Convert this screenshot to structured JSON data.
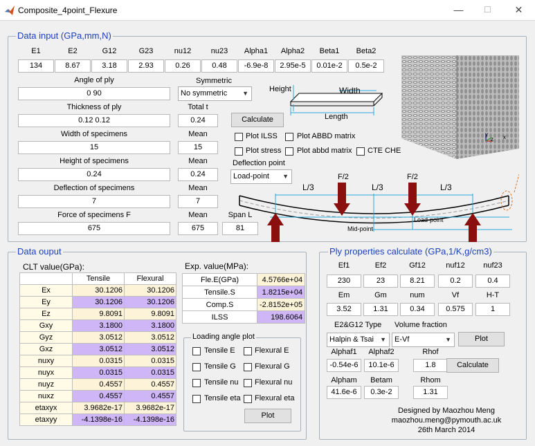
{
  "window": {
    "title": "Composite_4point_Flexure",
    "min": "—",
    "max": "☐",
    "close": "✕"
  },
  "data_input": {
    "title": "Data input (GPa,mm,N)",
    "props": [
      {
        "label": "E1",
        "value": "134"
      },
      {
        "label": "E2",
        "value": "8.67"
      },
      {
        "label": "G12",
        "value": "3.18"
      },
      {
        "label": "G23",
        "value": "2.93"
      },
      {
        "label": "nu12",
        "value": "0.26"
      },
      {
        "label": "nu23",
        "value": "0.48"
      },
      {
        "label": "Alpha1",
        "value": "-6.9e-8"
      },
      {
        "label": "Alpha2",
        "value": "2.95e-5"
      },
      {
        "label": "Beta1",
        "value": "0.01e-2"
      },
      {
        "label": "Beta2",
        "value": "0.5e-2"
      }
    ],
    "angle_label": "Angle of ply",
    "angle_value": "0 90",
    "symmetric_label": "Symmetric",
    "symmetric_value": "No symmetric",
    "thickness_label": "Thickness of ply",
    "thickness_value": "0.12 0.12",
    "total_label": "Total t",
    "total_value": "0.24",
    "width_label": "Width of specimens",
    "width_value": "15",
    "width_mean_label": "Mean",
    "width_mean": "15",
    "height_label": "Height of specimens",
    "height_value": "0.24",
    "height_mean_label": "Mean",
    "height_mean": "0.24",
    "deflection_label": "Deflection of specimens",
    "deflection_value": "7",
    "deflection_mean_label": "Mean",
    "deflection_mean": "7",
    "force_label": "Force of specimens F",
    "force_value": "675",
    "force_mean_label": "Mean",
    "force_mean": "675",
    "span_label": "Span L",
    "span_value": "81",
    "calculate": "Calculate",
    "plot_ilss": "Plot ILSS",
    "plot_abbd_upper": "Plot ABBD matrix",
    "plot_stress": "Plot stress",
    "plot_abbd_lower": "Plot abbd matrix",
    "cte_che": "CTE CHE",
    "deflection_point_label": "Deflection point",
    "deflection_point_value": "Load-point",
    "diagram": {
      "height": "Height",
      "width": "Width",
      "length": "Length",
      "f2_left": "F/2",
      "f2_right": "F/2",
      "l3_a": "L/3",
      "l3_b": "L/3",
      "l3_c": "L/3",
      "mid_point": "Mid-point",
      "load_point": "Load-point",
      "axis_y": "y",
      "axis_z": "z",
      "axis_x": "x"
    }
  },
  "data_output": {
    "title": "Data ouput",
    "clt_label": "CLT value(GPa):",
    "columns": [
      "",
      "Tensile",
      "Flexural"
    ],
    "rows": [
      {
        "name": "Ex",
        "tensile": "30.1206",
        "flexural": "30.1206"
      },
      {
        "name": "Ey",
        "tensile": "30.1206",
        "flexural": "30.1206"
      },
      {
        "name": "Ez",
        "tensile": "9.8091",
        "flexural": "9.8091"
      },
      {
        "name": "Gxy",
        "tensile": "3.1800",
        "flexural": "3.1800"
      },
      {
        "name": "Gyz",
        "tensile": "3.0512",
        "flexural": "3.0512"
      },
      {
        "name": "Gxz",
        "tensile": "3.0512",
        "flexural": "3.0512"
      },
      {
        "name": "nuxy",
        "tensile": "0.0315",
        "flexural": "0.0315"
      },
      {
        "name": "nuyx",
        "tensile": "0.0315",
        "flexural": "0.0315"
      },
      {
        "name": "nuyz",
        "tensile": "0.4557",
        "flexural": "0.4557"
      },
      {
        "name": "nuxz",
        "tensile": "0.4557",
        "flexural": "0.4557"
      },
      {
        "name": "etaxyx",
        "tensile": "3.9682e-17",
        "flexural": "3.9682e-17"
      },
      {
        "name": "etaxyy",
        "tensile": "-4.1398e-16",
        "flexural": "-4.1398e-16"
      }
    ],
    "exp_label": "Exp. value(MPa):",
    "exp_rows": [
      {
        "name": "Fle.E(GPa)",
        "value": "4.5766e+04",
        "color": "#fdf3d9"
      },
      {
        "name": "Tensile.S",
        "value": "1.8215e+04",
        "color": "#cfb6f7"
      },
      {
        "name": "Comp.S",
        "value": "-2.8152e+05",
        "color": "#fdf3d9"
      },
      {
        "name": "ILSS",
        "value": "198.6064",
        "color": "#cfb6f7"
      }
    ],
    "loading_title": "Loading angle plot",
    "loading": {
      "tensile_e": "Tensile E",
      "flexural_e": "Flexural E",
      "tensile_g": "Tensile G",
      "flexural_g": "Flexural G",
      "tensile_nu": "Tensile nu",
      "flexural_nu": "Flexural nu",
      "tensile_eta": "Tensile eta",
      "flexural_eta": "Flexural eta",
      "plot": "Plot"
    }
  },
  "ply": {
    "title": "Ply properties calculate (GPa,1/K,g/cm3)",
    "row1": [
      {
        "label": "Ef1",
        "value": "230"
      },
      {
        "label": "Ef2",
        "value": "23"
      },
      {
        "label": "Gf12",
        "value": "8.21"
      },
      {
        "label": "nuf12",
        "value": "0.2"
      },
      {
        "label": "nuf23",
        "value": "0.4"
      }
    ],
    "row2": [
      {
        "label": "Em",
        "value": "3.52"
      },
      {
        "label": "Gm",
        "value": "1.31"
      },
      {
        "label": "num",
        "value": "0.34"
      },
      {
        "label": "Vf",
        "value": "0.575"
      },
      {
        "label": "H-T",
        "value": "1"
      }
    ],
    "type_label": "E2&G12 Type",
    "type_value": "Halpin & Tsai",
    "vf_label": "Volume fraction",
    "vf_value": "E-Vf",
    "plot": "Plot",
    "row3": [
      {
        "label": "Alphaf1",
        "value": "-0.54e-6"
      },
      {
        "label": "Alphaf2",
        "value": "10.1e-6"
      },
      {
        "label": "Rhof",
        "value": "1.8"
      }
    ],
    "row4": [
      {
        "label": "Alpham",
        "value": "41.6e-6"
      },
      {
        "label": "Betam",
        "value": "0.3e-2"
      },
      {
        "label": "Rhom",
        "value": "1.31"
      }
    ],
    "calculate": "Calculate",
    "credit1": "Designed by Maozhou Meng",
    "credit2": "maozhou.meng@pymouth.ac.uk",
    "credit3": "26th March 2014"
  }
}
